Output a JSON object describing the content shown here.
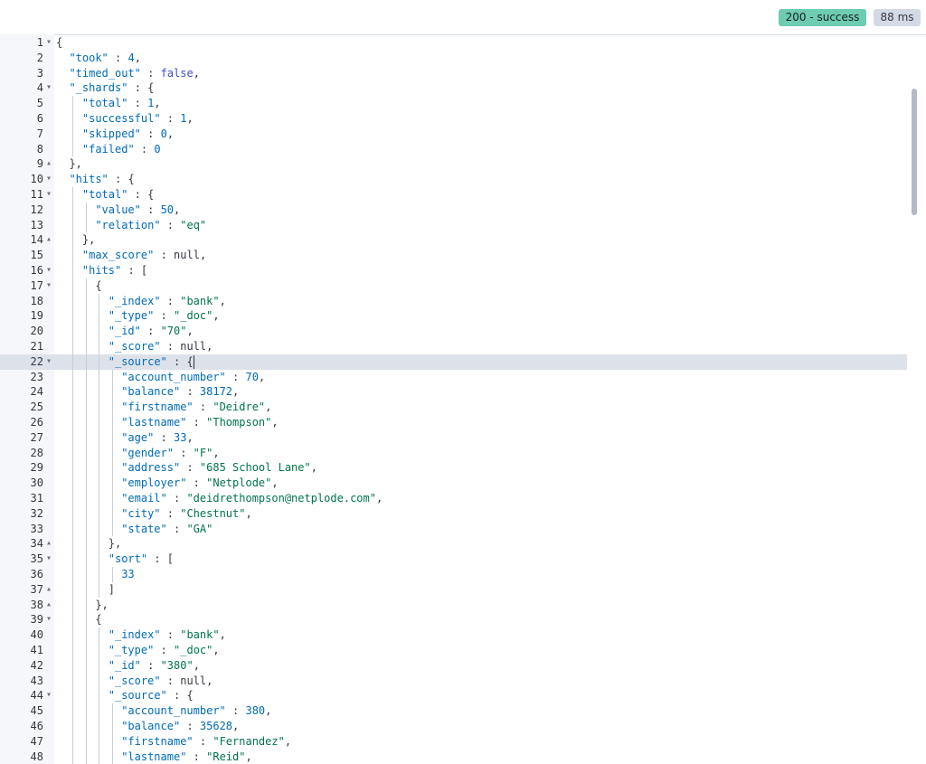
{
  "response": {
    "status_label": "200 - success",
    "time_label": "88 ms"
  },
  "editor": {
    "active_line": 22,
    "lines": [
      {
        "n": "1",
        "fold": "down",
        "indent": 0,
        "tokens": [
          [
            "p",
            "{"
          ]
        ]
      },
      {
        "n": "2",
        "indent": 1,
        "tokens": [
          [
            "k",
            "\"took\""
          ],
          [
            "p",
            " : "
          ],
          [
            "n",
            "4"
          ],
          [
            "p",
            ","
          ]
        ]
      },
      {
        "n": "3",
        "indent": 1,
        "tokens": [
          [
            "k",
            "\"timed_out\""
          ],
          [
            "p",
            " : "
          ],
          [
            "b",
            "false"
          ],
          [
            "p",
            ","
          ]
        ]
      },
      {
        "n": "4",
        "fold": "down",
        "indent": 1,
        "tokens": [
          [
            "k",
            "\"_shards\""
          ],
          [
            "p",
            " : {"
          ]
        ]
      },
      {
        "n": "5",
        "indent": 2,
        "tokens": [
          [
            "k",
            "\"total\""
          ],
          [
            "p",
            " : "
          ],
          [
            "n",
            "1"
          ],
          [
            "p",
            ","
          ]
        ]
      },
      {
        "n": "6",
        "indent": 2,
        "tokens": [
          [
            "k",
            "\"successful\""
          ],
          [
            "p",
            " : "
          ],
          [
            "n",
            "1"
          ],
          [
            "p",
            ","
          ]
        ]
      },
      {
        "n": "7",
        "indent": 2,
        "tokens": [
          [
            "k",
            "\"skipped\""
          ],
          [
            "p",
            " : "
          ],
          [
            "n",
            "0"
          ],
          [
            "p",
            ","
          ]
        ]
      },
      {
        "n": "8",
        "indent": 2,
        "tokens": [
          [
            "k",
            "\"failed\""
          ],
          [
            "p",
            " : "
          ],
          [
            "n",
            "0"
          ]
        ]
      },
      {
        "n": "9",
        "fold": "up",
        "indent": 1,
        "tokens": [
          [
            "p",
            "},"
          ]
        ]
      },
      {
        "n": "10",
        "fold": "down",
        "indent": 1,
        "tokens": [
          [
            "k",
            "\"hits\""
          ],
          [
            "p",
            " : {"
          ]
        ]
      },
      {
        "n": "11",
        "fold": "down",
        "indent": 2,
        "tokens": [
          [
            "k",
            "\"total\""
          ],
          [
            "p",
            " : {"
          ]
        ]
      },
      {
        "n": "12",
        "indent": 3,
        "tokens": [
          [
            "k",
            "\"value\""
          ],
          [
            "p",
            " : "
          ],
          [
            "n",
            "50"
          ],
          [
            "p",
            ","
          ]
        ]
      },
      {
        "n": "13",
        "indent": 3,
        "tokens": [
          [
            "k",
            "\"relation\""
          ],
          [
            "p",
            " : "
          ],
          [
            "s",
            "\"eq\""
          ]
        ]
      },
      {
        "n": "14",
        "fold": "up",
        "indent": 2,
        "tokens": [
          [
            "p",
            "},"
          ]
        ]
      },
      {
        "n": "15",
        "indent": 2,
        "tokens": [
          [
            "k",
            "\"max_score\""
          ],
          [
            "p",
            " : "
          ],
          [
            "p",
            "null"
          ],
          [
            "p",
            ","
          ]
        ]
      },
      {
        "n": "16",
        "fold": "down",
        "indent": 2,
        "tokens": [
          [
            "k",
            "\"hits\""
          ],
          [
            "p",
            " : ["
          ]
        ]
      },
      {
        "n": "17",
        "fold": "down",
        "indent": 3,
        "tokens": [
          [
            "p",
            "{"
          ]
        ]
      },
      {
        "n": "18",
        "indent": 4,
        "tokens": [
          [
            "k",
            "\"_index\""
          ],
          [
            "p",
            " : "
          ],
          [
            "s",
            "\"bank\""
          ],
          [
            "p",
            ","
          ]
        ]
      },
      {
        "n": "19",
        "indent": 4,
        "tokens": [
          [
            "k",
            "\"_type\""
          ],
          [
            "p",
            " : "
          ],
          [
            "s",
            "\"_doc\""
          ],
          [
            "p",
            ","
          ]
        ]
      },
      {
        "n": "20",
        "indent": 4,
        "tokens": [
          [
            "k",
            "\"_id\""
          ],
          [
            "p",
            " : "
          ],
          [
            "s",
            "\"70\""
          ],
          [
            "p",
            ","
          ]
        ]
      },
      {
        "n": "21",
        "indent": 4,
        "tokens": [
          [
            "k",
            "\"_score\""
          ],
          [
            "p",
            " : "
          ],
          [
            "p",
            "null"
          ],
          [
            "p",
            ","
          ]
        ]
      },
      {
        "n": "22",
        "fold": "down",
        "indent": 4,
        "cursor": true,
        "tokens": [
          [
            "k",
            "\"_source\""
          ],
          [
            "p",
            " : {"
          ]
        ]
      },
      {
        "n": "23",
        "indent": 5,
        "tokens": [
          [
            "k",
            "\"account_number\""
          ],
          [
            "p",
            " : "
          ],
          [
            "n",
            "70"
          ],
          [
            "p",
            ","
          ]
        ]
      },
      {
        "n": "24",
        "indent": 5,
        "tokens": [
          [
            "k",
            "\"balance\""
          ],
          [
            "p",
            " : "
          ],
          [
            "n",
            "38172"
          ],
          [
            "p",
            ","
          ]
        ]
      },
      {
        "n": "25",
        "indent": 5,
        "tokens": [
          [
            "k",
            "\"firstname\""
          ],
          [
            "p",
            " : "
          ],
          [
            "s",
            "\"Deidre\""
          ],
          [
            "p",
            ","
          ]
        ]
      },
      {
        "n": "26",
        "indent": 5,
        "tokens": [
          [
            "k",
            "\"lastname\""
          ],
          [
            "p",
            " : "
          ],
          [
            "s",
            "\"Thompson\""
          ],
          [
            "p",
            ","
          ]
        ]
      },
      {
        "n": "27",
        "indent": 5,
        "tokens": [
          [
            "k",
            "\"age\""
          ],
          [
            "p",
            " : "
          ],
          [
            "n",
            "33"
          ],
          [
            "p",
            ","
          ]
        ]
      },
      {
        "n": "28",
        "indent": 5,
        "tokens": [
          [
            "k",
            "\"gender\""
          ],
          [
            "p",
            " : "
          ],
          [
            "s",
            "\"F\""
          ],
          [
            "p",
            ","
          ]
        ]
      },
      {
        "n": "29",
        "indent": 5,
        "tokens": [
          [
            "k",
            "\"address\""
          ],
          [
            "p",
            " : "
          ],
          [
            "s",
            "\"685 School Lane\""
          ],
          [
            "p",
            ","
          ]
        ]
      },
      {
        "n": "30",
        "indent": 5,
        "tokens": [
          [
            "k",
            "\"employer\""
          ],
          [
            "p",
            " : "
          ],
          [
            "s",
            "\"Netplode\""
          ],
          [
            "p",
            ","
          ]
        ]
      },
      {
        "n": "31",
        "indent": 5,
        "tokens": [
          [
            "k",
            "\"email\""
          ],
          [
            "p",
            " : "
          ],
          [
            "s",
            "\"deidrethompson@netplode.com\""
          ],
          [
            "p",
            ","
          ]
        ]
      },
      {
        "n": "32",
        "indent": 5,
        "tokens": [
          [
            "k",
            "\"city\""
          ],
          [
            "p",
            " : "
          ],
          [
            "s",
            "\"Chestnut\""
          ],
          [
            "p",
            ","
          ]
        ]
      },
      {
        "n": "33",
        "indent": 5,
        "tokens": [
          [
            "k",
            "\"state\""
          ],
          [
            "p",
            " : "
          ],
          [
            "s",
            "\"GA\""
          ]
        ]
      },
      {
        "n": "34",
        "fold": "up",
        "indent": 4,
        "tokens": [
          [
            "p",
            "},"
          ]
        ]
      },
      {
        "n": "35",
        "fold": "down",
        "indent": 4,
        "tokens": [
          [
            "k",
            "\"sort\""
          ],
          [
            "p",
            " : ["
          ]
        ]
      },
      {
        "n": "36",
        "indent": 5,
        "tokens": [
          [
            "n",
            "33"
          ]
        ]
      },
      {
        "n": "37",
        "fold": "up",
        "indent": 4,
        "tokens": [
          [
            "p",
            "]"
          ]
        ]
      },
      {
        "n": "38",
        "fold": "up",
        "indent": 3,
        "tokens": [
          [
            "p",
            "},"
          ]
        ]
      },
      {
        "n": "39",
        "fold": "down",
        "indent": 3,
        "tokens": [
          [
            "p",
            "{"
          ]
        ]
      },
      {
        "n": "40",
        "indent": 4,
        "tokens": [
          [
            "k",
            "\"_index\""
          ],
          [
            "p",
            " : "
          ],
          [
            "s",
            "\"bank\""
          ],
          [
            "p",
            ","
          ]
        ]
      },
      {
        "n": "41",
        "indent": 4,
        "tokens": [
          [
            "k",
            "\"_type\""
          ],
          [
            "p",
            " : "
          ],
          [
            "s",
            "\"_doc\""
          ],
          [
            "p",
            ","
          ]
        ]
      },
      {
        "n": "42",
        "indent": 4,
        "tokens": [
          [
            "k",
            "\"_id\""
          ],
          [
            "p",
            " : "
          ],
          [
            "s",
            "\"380\""
          ],
          [
            "p",
            ","
          ]
        ]
      },
      {
        "n": "43",
        "indent": 4,
        "tokens": [
          [
            "k",
            "\"_score\""
          ],
          [
            "p",
            " : "
          ],
          [
            "p",
            "null"
          ],
          [
            "p",
            ","
          ]
        ]
      },
      {
        "n": "44",
        "fold": "down",
        "indent": 4,
        "tokens": [
          [
            "k",
            "\"_source\""
          ],
          [
            "p",
            " : {"
          ]
        ]
      },
      {
        "n": "45",
        "indent": 5,
        "tokens": [
          [
            "k",
            "\"account_number\""
          ],
          [
            "p",
            " : "
          ],
          [
            "n",
            "380"
          ],
          [
            "p",
            ","
          ]
        ]
      },
      {
        "n": "46",
        "indent": 5,
        "tokens": [
          [
            "k",
            "\"balance\""
          ],
          [
            "p",
            " : "
          ],
          [
            "n",
            "35628"
          ],
          [
            "p",
            ","
          ]
        ]
      },
      {
        "n": "47",
        "indent": 5,
        "tokens": [
          [
            "k",
            "\"firstname\""
          ],
          [
            "p",
            " : "
          ],
          [
            "s",
            "\"Fernandez\""
          ],
          [
            "p",
            ","
          ]
        ]
      },
      {
        "n": "48",
        "indent": 5,
        "tokens": [
          [
            "k",
            "\"lastname\""
          ],
          [
            "p",
            " : "
          ],
          [
            "s",
            "\"Reid\""
          ],
          [
            "p",
            ","
          ]
        ]
      }
    ]
  },
  "colors": {
    "key": "#006bb8",
    "string": "#00754a",
    "number": "#006bb8",
    "boolean": "#3f4bd0",
    "status_badge": "#6dccb1",
    "time_badge": "#d3dae6",
    "active_line": "#dde1e9"
  }
}
